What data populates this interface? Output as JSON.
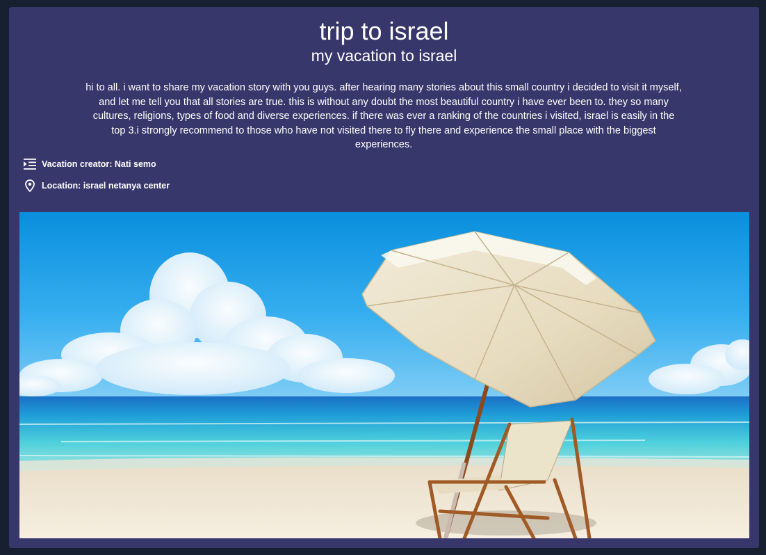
{
  "vacation": {
    "title": "trip to israel",
    "subtitle": "my vacation to israel",
    "description": "hi to all. i want to share my vacation story with you guys. after hearing many stories about this small country i decided to visit it myself, and let me tell you that all stories are true. this is without any doubt the most beautiful country i have ever been to. they so many cultures, religions, types of food and diverse experiences. if there was ever a ranking of the countries i visited, israel is easily in the top 3.i strongly recommend to those who have not visited there to fly there and experience the small place with the biggest experiences.",
    "creator_text": "Vacation creator: Nati semo",
    "location_text": "Location: israel netanya center"
  },
  "icons": {
    "creator": "list-indent-icon",
    "location": "map-pin-icon"
  },
  "colors": {
    "page_background": "#172030",
    "card_background": "#37376b",
    "text": "#ffffff"
  }
}
